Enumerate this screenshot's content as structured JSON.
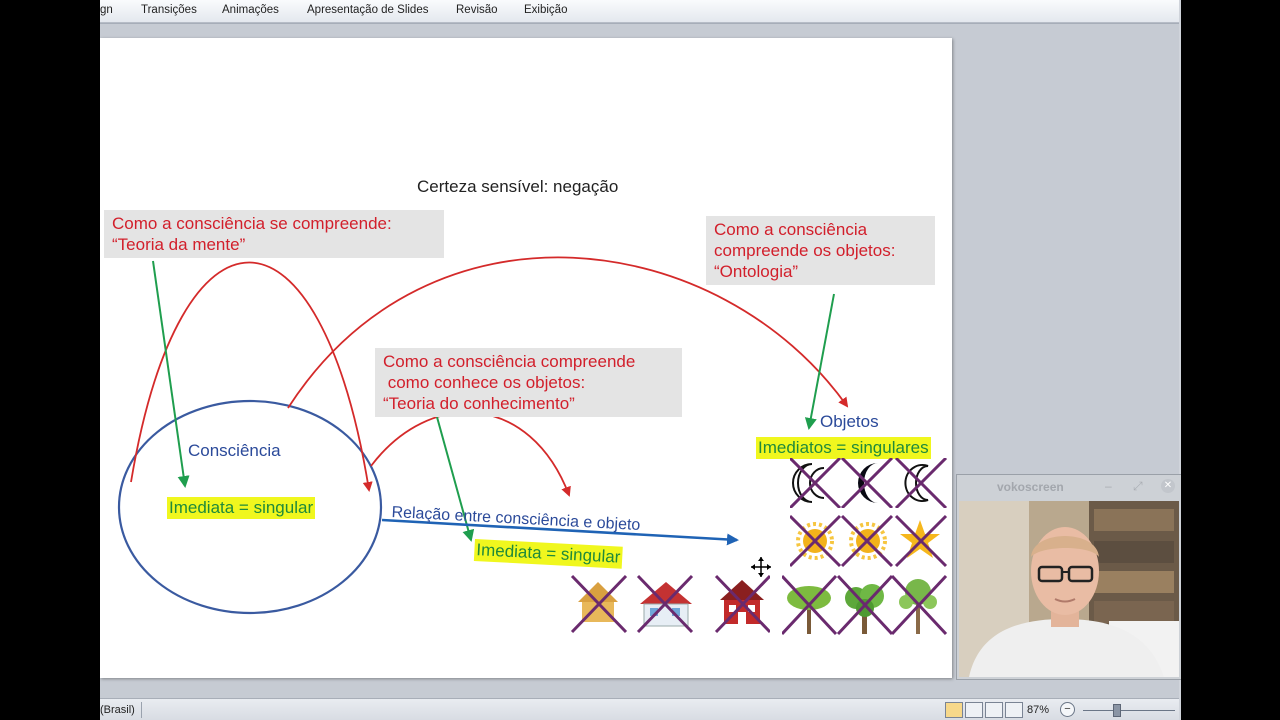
{
  "ribbon": {
    "tabs": [
      "gn",
      "Transições",
      "Animações",
      "Apresentação de Slides",
      "Revisão",
      "Exibição"
    ]
  },
  "slide": {
    "title": "Certeza sensível: negação",
    "box_mente": "Como a consciência se compreende:\n“Teoria da mente”",
    "box_ontologia": "Como a consciência\ncompreende os objetos:\n“Ontologia”",
    "box_conhecimento": "Como a consciência compreende\n como conhece os objetos:\n“Teoria do conhecimento”",
    "consciencia_label": "Consciência",
    "consciencia_singular": "Imediata = singular",
    "relacao_label": "Relação entre consciência e objeto",
    "relacao_singular": "Imediata = singular",
    "objetos_label": "Objetos",
    "objetos_singulares": "Imediatos = singulares",
    "object_icons": [
      "moon-icon",
      "moon-icon",
      "moon-icon",
      "sun-icon",
      "sun-icon",
      "sun-icon",
      "tree-icon",
      "tree-icon",
      "tree-icon",
      "house-icon",
      "house-icon",
      "house-icon"
    ]
  },
  "statusbar": {
    "language": "(Brasil)",
    "zoom": "87%"
  },
  "webcam": {
    "title": "vokoscreen"
  },
  "colors": {
    "red_text": "#d21f2b",
    "blue_text": "#2b4a9a",
    "highlight": "#f0f71e",
    "green_arrow": "#1f9e4e",
    "blue_arrow": "#1f63b5",
    "cross": "#6a2a6e"
  }
}
